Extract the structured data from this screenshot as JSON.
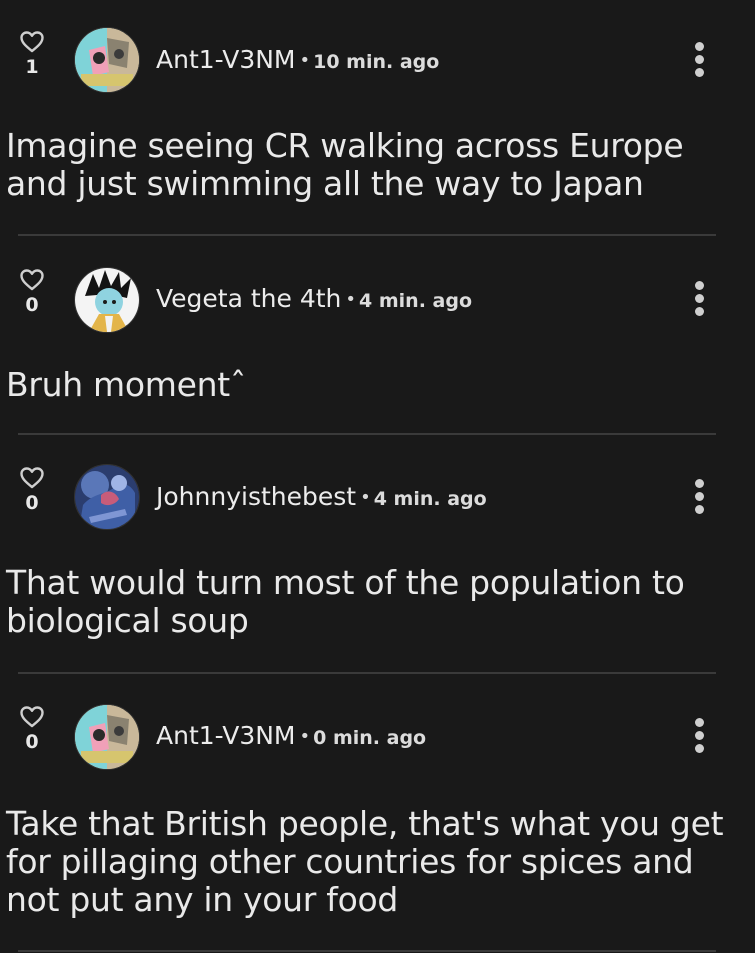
{
  "comments": [
    {
      "likes": "1",
      "username": "Ant1-V3NM",
      "separator": "•",
      "time": "10 min. ago",
      "text": "Imagine seeing CR walking across Europe and just swimming all the way to Japan",
      "avatar": "avatar-ant1"
    },
    {
      "likes": "0",
      "username": "Vegeta the 4th",
      "separator": "•",
      "time": "4 min. ago",
      "text": "Bruh momentˆ",
      "avatar": "avatar-vegeta"
    },
    {
      "likes": "0",
      "username": "Johnnyisthebest",
      "separator": "•",
      "time": "4 min. ago",
      "text": "That would turn most of the population to biological soup",
      "avatar": "avatar-johnny"
    },
    {
      "likes": "0",
      "username": "Ant1-V3NM",
      "separator": "•",
      "time": "0 min. ago",
      "text": "Take that British people, that's what you get for pillaging other countries for spices and not put any in your food",
      "avatar": "avatar-ant1"
    }
  ],
  "icons": {
    "like": "heart-outline-icon",
    "menu": "kebab-menu-icon"
  },
  "colors": {
    "background": "#191919",
    "text": "#e9e9e9",
    "divider": "#3a3a3a"
  }
}
